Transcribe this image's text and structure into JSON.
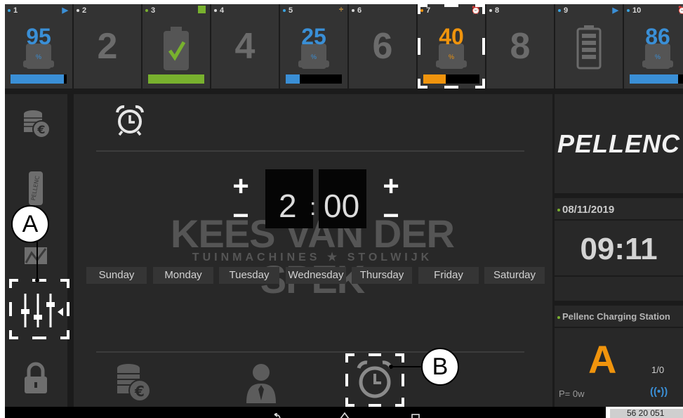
{
  "slots": [
    {
      "index": "1",
      "value": "95",
      "unit": "%",
      "fill": 0.95,
      "color": "#3a8fd6",
      "status_icon": "play-icon",
      "status_color": "#3a8fd6",
      "dot": "blue"
    },
    {
      "index": "2",
      "value": "2",
      "unit": "",
      "fill": 0,
      "color": "#6b6b6b",
      "status_icon": "",
      "dot": "plain"
    },
    {
      "index": "3",
      "value": "",
      "unit": "",
      "fill": 1.0,
      "color": "#78b12e",
      "status_icon": "square-icon",
      "status_color": "#78b12e",
      "dot": "green"
    },
    {
      "index": "4",
      "value": "4",
      "unit": "",
      "fill": 0,
      "color": "#6b6b6b",
      "status_icon": "",
      "dot": "plain"
    },
    {
      "index": "5",
      "value": "25",
      "unit": "%",
      "fill": 0.25,
      "color": "#3a8fd6",
      "status_icon": "divide-icon",
      "status_color": "#e2a540",
      "dot": "blue"
    },
    {
      "index": "6",
      "value": "6",
      "unit": "",
      "fill": 0,
      "color": "#6b6b6b",
      "status_icon": "",
      "dot": "plain"
    },
    {
      "index": "7",
      "value": "40",
      "unit": "%",
      "fill": 0.4,
      "color": "#f0940d",
      "status_icon": "alarm-clock-icon",
      "status_color": "#f0940d",
      "dot": "orange"
    },
    {
      "index": "8",
      "value": "8",
      "unit": "",
      "fill": 0,
      "color": "#6b6b6b",
      "status_icon": "",
      "dot": "plain"
    },
    {
      "index": "9",
      "value": "",
      "unit": "",
      "fill": 0,
      "color": "#6b6b6b",
      "status_icon": "play-icon",
      "status_color": "#3a8fd6",
      "dot": "blue"
    },
    {
      "index": "10",
      "value": "86",
      "unit": "%",
      "fill": 0.86,
      "color": "#3a8fd6",
      "status_icon": "alarm-clock-icon",
      "status_color": "#f0940d",
      "dot": "blue"
    }
  ],
  "timer": {
    "hours": "2",
    "separator": ":",
    "minutes": "00",
    "plus": "+",
    "minus": "−"
  },
  "days": [
    "Sunday",
    "Monday",
    "Tuesday",
    "Wednesday",
    "Thursday",
    "Friday",
    "Saturday"
  ],
  "watermark": {
    "title": "KEES VAN DER SPEK",
    "subtitle": "TUINMACHINES ★ STOLWIJK"
  },
  "brand": {
    "logo": "PELLENC"
  },
  "clock": {
    "date": "08/11/2019",
    "time": "09:11"
  },
  "station": {
    "name": "Pellenc Charging Station",
    "letter": "A",
    "ratio": "1/0",
    "power": "P= 0w",
    "wireless": "((•))"
  },
  "coordinates": "56 20 051",
  "callouts": {
    "a": "A",
    "b": "B"
  },
  "colors": {
    "blue": "#3a8fd6",
    "orange": "#f0940d",
    "green": "#78b12e",
    "grey": "#6b6b6b"
  }
}
